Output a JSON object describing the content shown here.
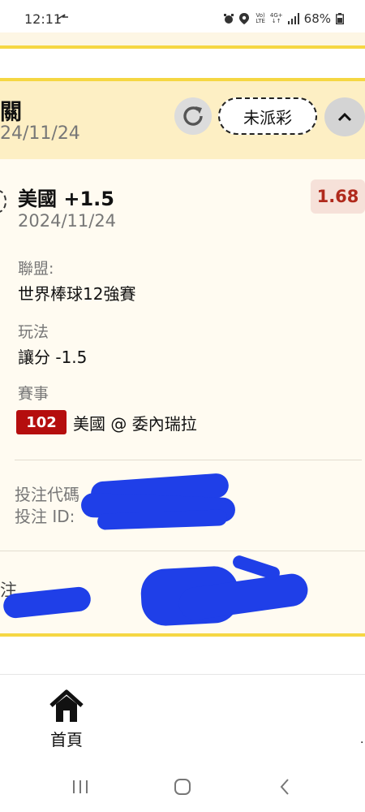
{
  "status_bar": {
    "time": "12:11",
    "battery": "68%",
    "icons": [
      "navigation-arrow-icon",
      "alarm-icon",
      "location-icon",
      "volte-icon",
      "4g-icon",
      "signal-icon",
      "battery-icon"
    ]
  },
  "bet_card": {
    "title": "關",
    "date": "24/11/24",
    "status_label": "未派彩",
    "selection": "美國 +1.5",
    "bet_date": "2024/11/24",
    "odds": "1.68",
    "league_label": "聯盟:",
    "league_value": "世界棒球12強賽",
    "play_label": "玩法",
    "play_value": "讓分 -1.5",
    "event_label": "賽事",
    "event_number": "102",
    "event_name": "美國 @ 委內瑞拉",
    "code_label": "投注代碼",
    "id_label": "投注 ID:",
    "footer_label": "注"
  },
  "bottom_nav": {
    "home_label": "首頁",
    "edge_char": "·"
  },
  "colors": {
    "accent_yellow": "#f5d743",
    "header_bg": "#fdefc4",
    "card_bg": "#fffbf1",
    "odds_text": "#b02a1c",
    "event_badge": "#b50e0e",
    "redaction": "#1f3fe8"
  }
}
